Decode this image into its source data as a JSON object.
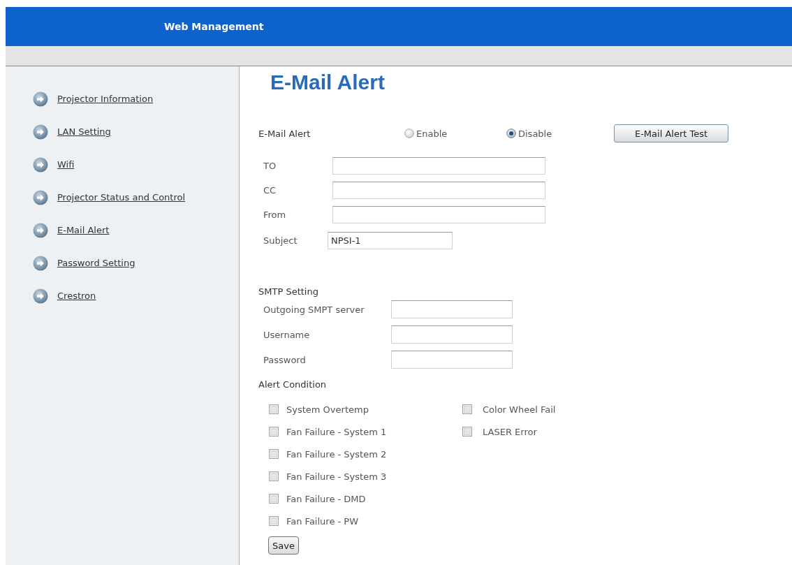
{
  "header": {
    "title": "Web Management"
  },
  "sidebar": {
    "items": [
      {
        "label": "Projector Information"
      },
      {
        "label": "LAN Setting"
      },
      {
        "label": "Wifi"
      },
      {
        "label": "Projector Status and Control"
      },
      {
        "label": "E-Mail Alert"
      },
      {
        "label": "Password Setting"
      },
      {
        "label": "Crestron"
      }
    ]
  },
  "main": {
    "title": "E-Mail Alert",
    "alert_switch": {
      "label": "E-Mail Alert",
      "options": [
        {
          "label": "Enable",
          "selected": false
        },
        {
          "label": "Disable",
          "selected": true
        }
      ],
      "test_button": "E-Mail Alert Test"
    },
    "mail_fields": [
      {
        "label": "TO"
      },
      {
        "label": "CC"
      },
      {
        "label": "From"
      }
    ],
    "subject": {
      "label": "Subject",
      "value": "NPSI-1"
    },
    "smtp_setting": {
      "title": "SMTP Setting",
      "fields": [
        {
          "label": "Outgoing SMPT server"
        },
        {
          "label": "Username"
        },
        {
          "label": "Password"
        }
      ]
    },
    "alert_condition": {
      "title": "Alert Condition",
      "columns": [
        {
          "items": [
            {
              "label": "System Overtemp",
              "checked": false
            },
            {
              "label": "Fan Failure - System 1",
              "checked": false
            },
            {
              "label": "Fan Failure - System 2",
              "checked": false
            },
            {
              "label": "Fan Failure - System 3",
              "checked": false
            },
            {
              "label": "Fan Failure - DMD",
              "checked": false
            },
            {
              "label": "Fan Failure - PW",
              "checked": false
            }
          ]
        },
        {
          "items": [
            {
              "label": "Color Wheel Fail",
              "checked": false
            },
            {
              "label": "LASER Error",
              "checked": false
            }
          ]
        }
      ]
    },
    "save_button": "Save"
  }
}
